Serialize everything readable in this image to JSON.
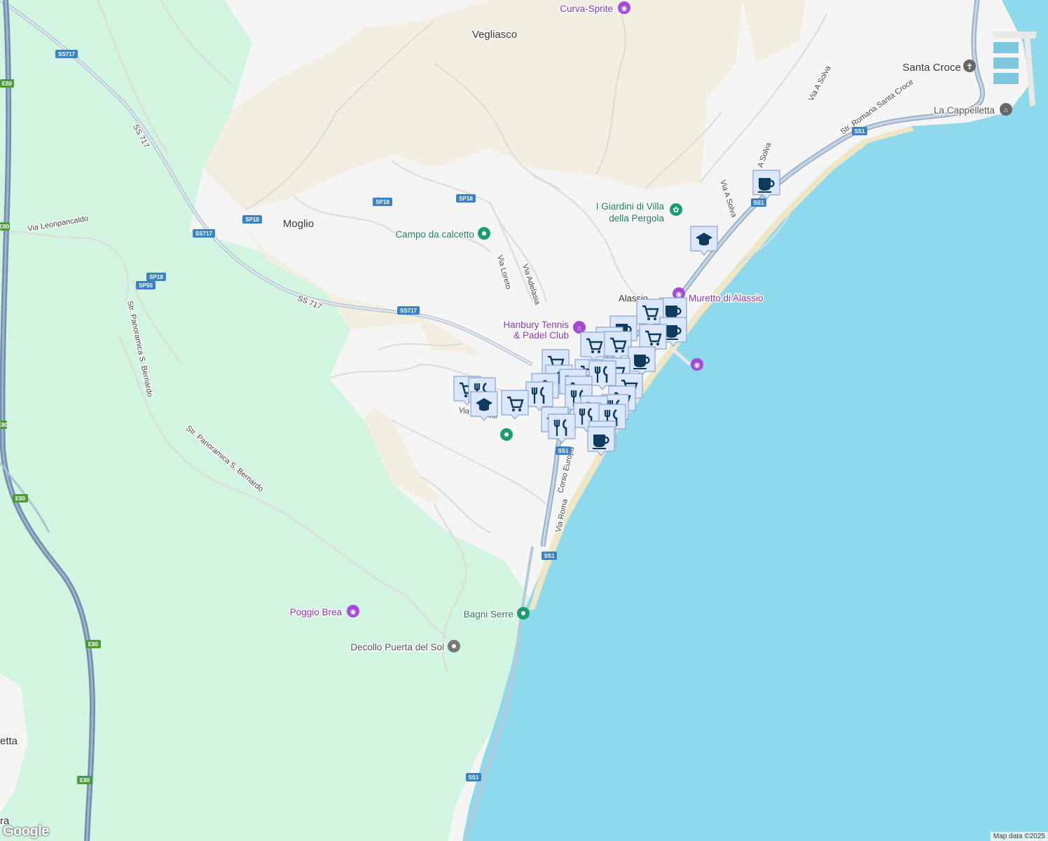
{
  "map": {
    "places": [
      {
        "id": "vegliasco",
        "label": "Vegliasco"
      },
      {
        "id": "moglio",
        "label": "Moglio"
      },
      {
        "id": "santa-croce",
        "label": "Santa Croce"
      },
      {
        "id": "alassio",
        "label": "Alassio"
      },
      {
        "id": "etta",
        "label": "etta"
      },
      {
        "id": "ra",
        "label": "ra"
      }
    ],
    "pois": [
      {
        "id": "curva-sprite",
        "label": "Curva-Sprite",
        "type": "viewpoint"
      },
      {
        "id": "campo",
        "label": "Campo da calcetto",
        "type": "sport"
      },
      {
        "id": "giardini1",
        "label": "I Giardini di Villa",
        "type": "garden"
      },
      {
        "id": "giardini2",
        "label": "della Pergola",
        "type": "garden"
      },
      {
        "id": "muretto",
        "label": "Muretto di Alassio",
        "type": "viewpoint"
      },
      {
        "id": "hanbury1",
        "label": "Hanbury Tennis",
        "type": "museum"
      },
      {
        "id": "hanbury2",
        "label": "& Padel Club",
        "type": "museum"
      },
      {
        "id": "cappelletta",
        "label": "La Cappelletta",
        "type": "museum"
      },
      {
        "id": "bagni-serre",
        "label": "Bagni Serre",
        "type": "park"
      },
      {
        "id": "poggio-brea",
        "label": "Poggio Brea",
        "type": "viewpoint"
      },
      {
        "id": "decollo",
        "label": "Decollo Puerta del Sol",
        "type": "place"
      }
    ],
    "streets": [
      {
        "id": "ss717-label",
        "label": "SS 717"
      },
      {
        "id": "ss717-diag",
        "label": "SS 717"
      },
      {
        "id": "via-leonpancaldo",
        "label": "Via Leonpancaldo"
      },
      {
        "id": "panoramica1",
        "label": "Str. Panoramica S. Bernardo"
      },
      {
        "id": "panoramica2",
        "label": "Str. Panoramica S. Bernardo"
      },
      {
        "id": "via-loreto",
        "label": "Via Loreto"
      },
      {
        "id": "via-adelasia",
        "label": "Via Adelasia"
      },
      {
        "id": "via-negrelli",
        "label": "Via Negrelli"
      },
      {
        "id": "corso-europa",
        "label": "Corso Europa"
      },
      {
        "id": "via-roma",
        "label": "Via Roma"
      },
      {
        "id": "via-a-solva",
        "label": "Via A Solva"
      },
      {
        "id": "via-a-solva2",
        "label": "Via A Solva"
      },
      {
        "id": "via-a-solva3",
        "label": "A Solva"
      },
      {
        "id": "str-romana",
        "label": "Str. Romana Santa Croce"
      }
    ],
    "shields": [
      {
        "id": "ss717-a",
        "label": "SS717"
      },
      {
        "id": "ss717-b",
        "label": "SS717"
      },
      {
        "id": "ss717-c",
        "label": "SS717"
      },
      {
        "id": "sp18-a",
        "label": "SP18"
      },
      {
        "id": "sp18-b",
        "label": "SP18"
      },
      {
        "id": "sp18-c",
        "label": "SP18"
      },
      {
        "id": "sp18-d",
        "label": "SP18"
      },
      {
        "id": "sp55",
        "label": "SP55"
      },
      {
        "id": "e80-a",
        "label": "E80"
      },
      {
        "id": "e80-b",
        "label": "E80"
      },
      {
        "id": "e80-c",
        "label": "E80"
      },
      {
        "id": "e80-d",
        "label": "E80"
      },
      {
        "id": "e80-e",
        "label": "E80"
      },
      {
        "id": "e80-f",
        "label": "E80"
      },
      {
        "id": "ss1-a",
        "label": "SS1"
      },
      {
        "id": "ss1-b",
        "label": "SS1"
      },
      {
        "id": "ss1-c",
        "label": "SS1"
      },
      {
        "id": "ss1-d",
        "label": "SS1"
      },
      {
        "id": "ss1-e",
        "label": "SS1"
      }
    ],
    "colors": {
      "sea": "#8fd9ec",
      "land": "#f5f5f5",
      "forest": "#d2f5e2",
      "sand": "#f2eee0",
      "highway": "#6f8fae",
      "shield_green": "#4a9a3e",
      "marker_fill": "#dbe7fd",
      "marker_icon": "#0e3a5e"
    },
    "attribution": "Map data ©2025",
    "logo": "Google"
  }
}
